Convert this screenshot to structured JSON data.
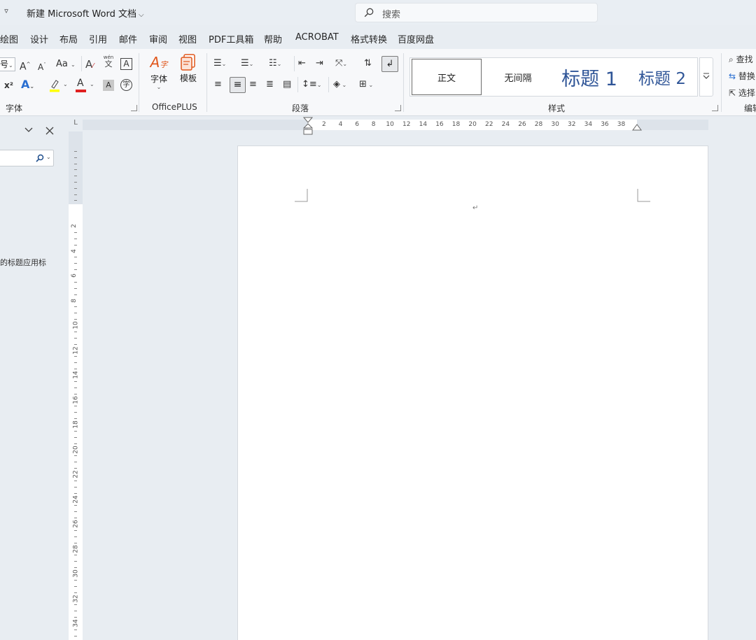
{
  "title_bar": {
    "qat_more": "▿",
    "doc_title": "新建 Microsoft Word 文档",
    "search_placeholder": "搜索"
  },
  "menu_tabs": [
    "绘图",
    "设计",
    "布局",
    "引用",
    "邮件",
    "审阅",
    "视图",
    "PDF工具箱",
    "帮助",
    "ACROBAT",
    "格式转换",
    "百度网盘"
  ],
  "ribbon": {
    "font_group": {
      "label": "字体",
      "font_size_fragment": "号",
      "grow_font": "A",
      "shrink_font": "A",
      "change_case": "Aa",
      "phonetic_top": "wén",
      "phonetic_bottom": "文",
      "char_border": "A",
      "superscript": "x²",
      "text_effects": "A",
      "font_color": "A",
      "char_shading": "A",
      "enclose_char": "字",
      "highlight_color": "#ffff00",
      "font_color_value": "#e02020"
    },
    "officeplus_group": {
      "label": "OfficePLUS",
      "font_button": "字体",
      "template_button": "模板"
    },
    "paragraph_group": {
      "label": "段落"
    },
    "styles_group": {
      "label": "样式",
      "styles": [
        "正文",
        "无间隔",
        "标题 1",
        "标题 2"
      ]
    },
    "editing_group": {
      "label": "编辑",
      "find": "查找",
      "replace": "替换",
      "select": "选择"
    }
  },
  "nav_pane": {
    "text_fragment": "的标题应用标"
  },
  "ruler": {
    "corner": "L",
    "h_numbers": [
      "2",
      "4",
      "6",
      "8",
      "10",
      "12",
      "14",
      "16",
      "18",
      "20",
      "22",
      "24",
      "26",
      "28",
      "30",
      "32",
      "34",
      "36",
      "38"
    ],
    "v_numbers": [
      "2",
      "4",
      "6",
      "8",
      "10",
      "12",
      "14",
      "16",
      "18",
      "20",
      "22",
      "24",
      "26",
      "28",
      "30",
      "32",
      "34"
    ]
  },
  "document": {
    "paragraph_mark": "↵"
  }
}
